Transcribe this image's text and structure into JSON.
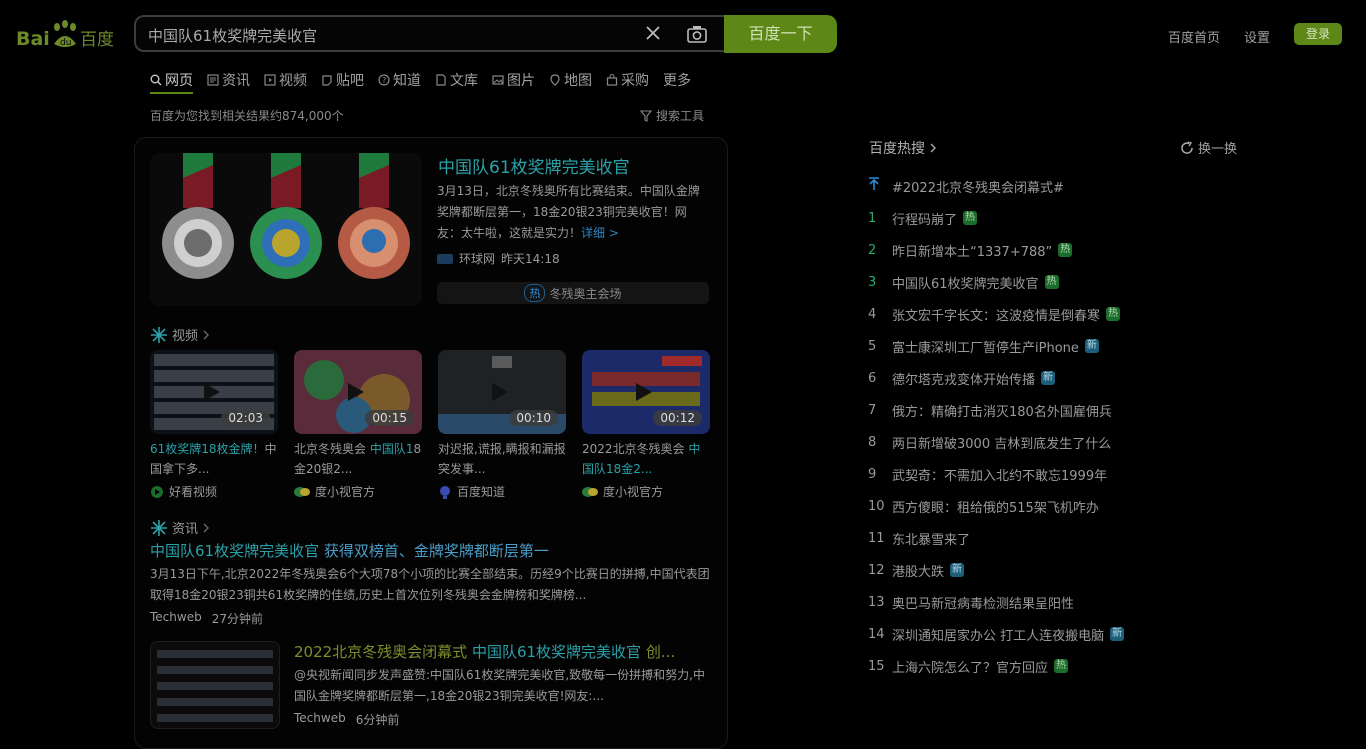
{
  "logo": {
    "text_left": "Bai",
    "text_right": "百度"
  },
  "search": {
    "query": "中国队61枚奖牌完美收官",
    "button": "百度一下"
  },
  "header": {
    "home": "百度首页",
    "settings": "设置",
    "login": "登录"
  },
  "tabs": [
    {
      "label": "网页",
      "icon": "search-icon",
      "active": true
    },
    {
      "label": "资讯",
      "icon": "news-icon"
    },
    {
      "label": "视频",
      "icon": "video-icon"
    },
    {
      "label": "贴吧",
      "icon": "tieba-icon"
    },
    {
      "label": "知道",
      "icon": "question-icon"
    },
    {
      "label": "文库",
      "icon": "doc-icon"
    },
    {
      "label": "图片",
      "icon": "image-icon"
    },
    {
      "label": "地图",
      "icon": "map-icon"
    },
    {
      "label": "采购",
      "icon": "bag-icon"
    },
    {
      "label": "更多"
    }
  ],
  "result_count": "百度为您找到相关结果约874,000个",
  "search_tools": "搜索工具",
  "top_result": {
    "title": "中国队61枚奖牌完美收官",
    "desc": "3月13日，北京冬残奥所有比赛结束。中国队金牌奖牌都断层第一，18金20银23铜完美收官！网友：太牛啦，这就是实力！",
    "more": "详细 >",
    "source": "环球网",
    "time": "昨天14:18",
    "hot_tag": "热",
    "hot_text": "冬残奥主会场"
  },
  "video_section": {
    "label": "视频",
    "items": [
      {
        "title_hl": "61枚奖牌18枚金牌！",
        "title": "中国拿下多...",
        "duration": "02:03",
        "source": "好看视频"
      },
      {
        "title": "北京冬残奥会 ",
        "title_hl": "中国队1",
        "title2": "8金20银2...",
        "duration": "00:15",
        "source": "度小视官方"
      },
      {
        "title": "对迟报,谎报,瞒报和漏报突发事...",
        "duration": "00:10",
        "source": "百度知道"
      },
      {
        "title": "2022北京冬残奥会 ",
        "title_hl": "中国队18金2...",
        "duration": "00:12",
        "source": "度小视官方"
      }
    ]
  },
  "news_section": {
    "label": "资讯",
    "item1": {
      "title_hl": "中国队61枚奖牌完美收官",
      "title_rest": " 获得双榜首、金牌奖牌都断层第一",
      "desc": "3月13日下午,北京2022年冬残奥会6个大项78个小项的比赛全部结束。历经9个比赛日的拼搏,中国代表团取得18金20银23铜共61枚奖牌的佳绩,历史上首次位列冬残奥会金牌榜和奖牌榜...",
      "source": "Techweb",
      "time": "27分钟前"
    },
    "item2": {
      "title": "2022北京冬残奥会闭幕式 ",
      "title_hl": "中国队61枚奖牌完美收官",
      "title_end": " 创...",
      "desc": "@央视新闻同步发声盛赞:中国队61枚奖牌完美收官,致敬每一份拼搏和努力,中国队金牌奖牌都断层第一,18金20银23铜完美收官!网友:...",
      "source": "Techweb",
      "time": "6分钟前"
    }
  },
  "hot": {
    "title": "百度热搜",
    "refresh": "换一换",
    "items": [
      {
        "idx": "",
        "text": "#2022北京冬残奥会闭幕式#",
        "pinned": true
      },
      {
        "idx": "1",
        "text": "行程码崩了",
        "badge": "热"
      },
      {
        "idx": "2",
        "text": "昨日新增本土“1337+788”",
        "badge": "热"
      },
      {
        "idx": "3",
        "text": "中国队61枚奖牌完美收官",
        "badge": "热"
      },
      {
        "idx": "4",
        "text": "张文宏千字长文：这波疫情是倒春寒",
        "badge": "热"
      },
      {
        "idx": "5",
        "text": "富士康深圳工厂暂停生产iPhone",
        "badge": "新"
      },
      {
        "idx": "6",
        "text": "德尔塔克戎变体开始传播",
        "badge": "新"
      },
      {
        "idx": "7",
        "text": "俄方：精确打击消灭180名外国雇佣兵"
      },
      {
        "idx": "8",
        "text": "两日新增破3000 吉林到底发生了什么"
      },
      {
        "idx": "9",
        "text": "武契奇：不需加入北约不敢忘1999年"
      },
      {
        "idx": "10",
        "text": "西方傻眼：租给俄的515架飞机咋办"
      },
      {
        "idx": "11",
        "text": "东北暴雪来了"
      },
      {
        "idx": "12",
        "text": "港股大跌",
        "badge": "新"
      },
      {
        "idx": "13",
        "text": "奥巴马新冠病毒检测结果呈阳性"
      },
      {
        "idx": "14",
        "text": "深圳通知居家办公 打工人连夜搬电脑",
        "badge": "新"
      },
      {
        "idx": "15",
        "text": "上海六院怎么了？官方回应",
        "badge": "热"
      }
    ]
  }
}
